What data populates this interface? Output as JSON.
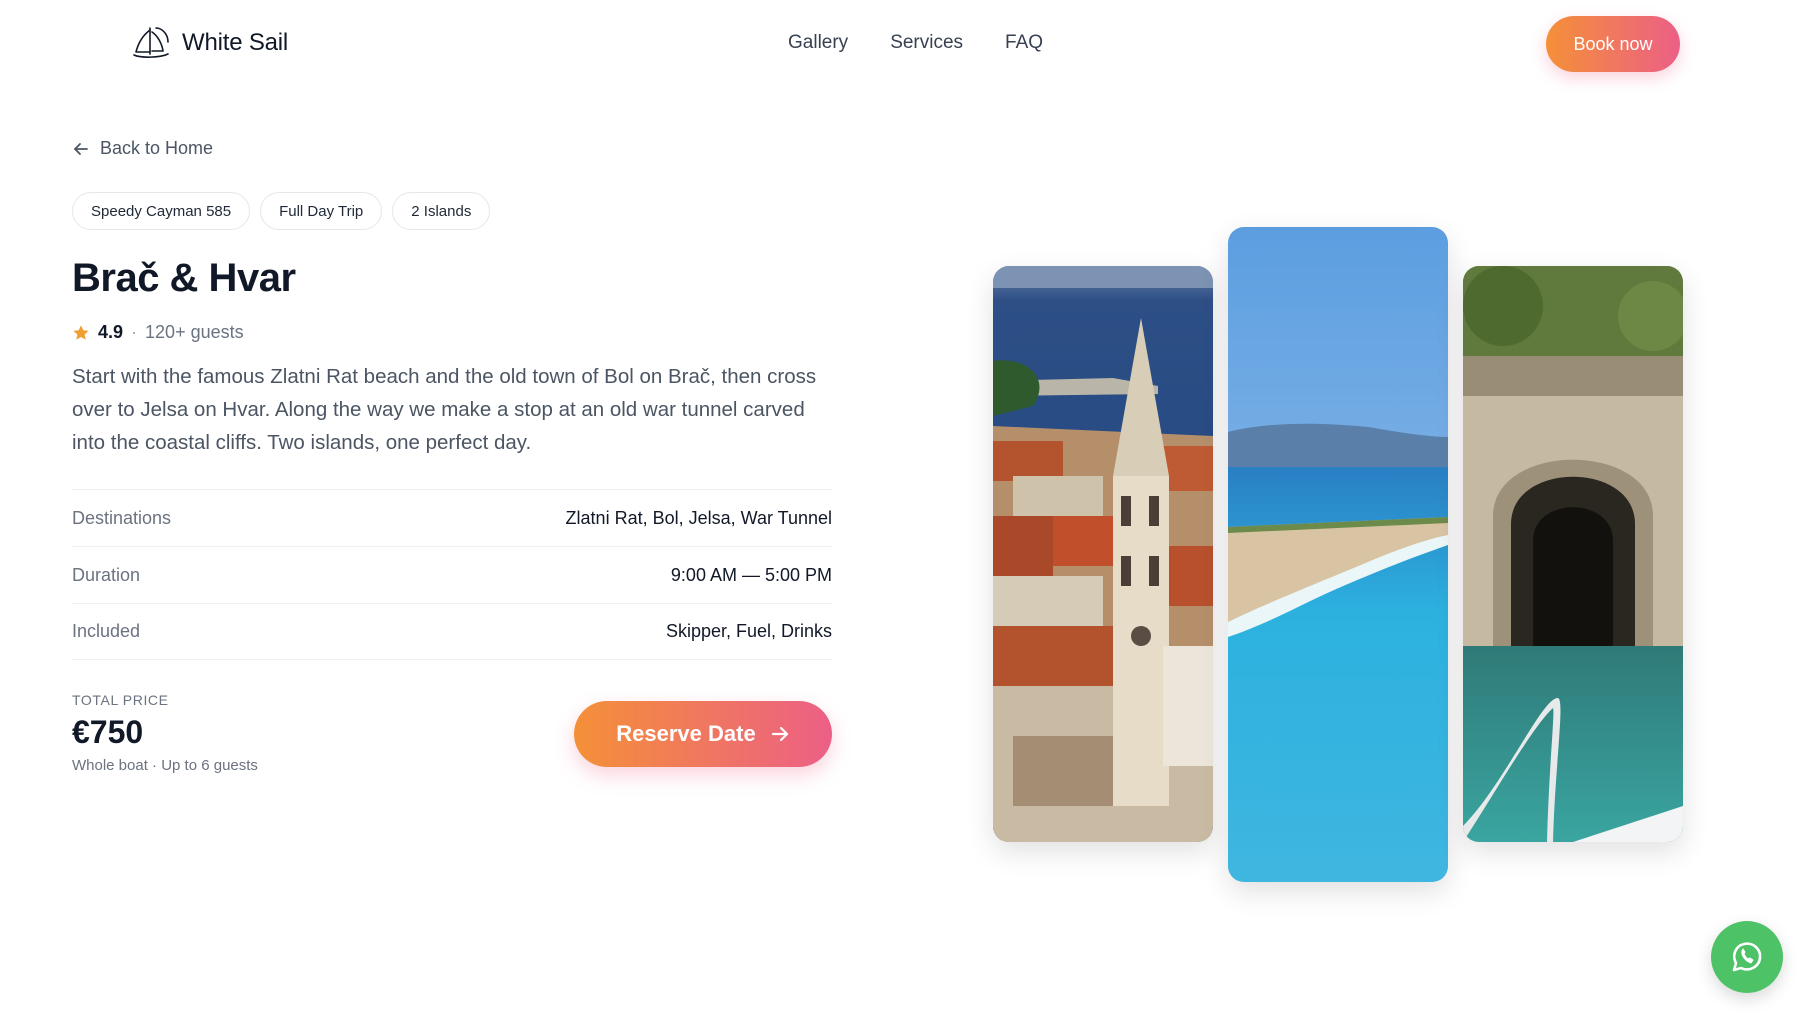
{
  "header": {
    "brand": "White Sail",
    "nav": [
      "Gallery",
      "Services",
      "FAQ"
    ],
    "book_label": "Book now"
  },
  "back_label": "Back to Home",
  "tags": [
    "Speedy Cayman 585",
    "Full Day Trip",
    "2 Islands"
  ],
  "tour": {
    "title": "Brač & Hvar",
    "rating": "4.9",
    "rating_sep": "·",
    "guests": "120+ guests",
    "description": "Start with the famous Zlatni Rat beach and the old town of Bol on Brač, then cross over to Jelsa on Hvar. Along the way we make a stop at an old war tunnel carved into the coastal cliffs. Two islands, one perfect day."
  },
  "details": [
    {
      "label": "Destinations",
      "value": "Zlatni Rat, Bol, Jelsa, War Tunnel"
    },
    {
      "label": "Duration",
      "value": "9:00 AM — 5:00 PM"
    },
    {
      "label": "Included",
      "value": "Skipper, Fuel, Drinks"
    }
  ],
  "price": {
    "label": "TOTAL PRICE",
    "value": "€750",
    "note": "Whole boat · Up to 6 guests"
  },
  "reserve_label": "Reserve Date",
  "photos": [
    {
      "icon": "jelsa-church-photo"
    },
    {
      "icon": "zlatni-rat-beach-photo"
    },
    {
      "icon": "war-tunnel-photo"
    }
  ],
  "colors": {
    "accent_start": "#f49038",
    "accent_end": "#ec5f86",
    "star": "#f0a030",
    "whatsapp": "#4dc266"
  }
}
